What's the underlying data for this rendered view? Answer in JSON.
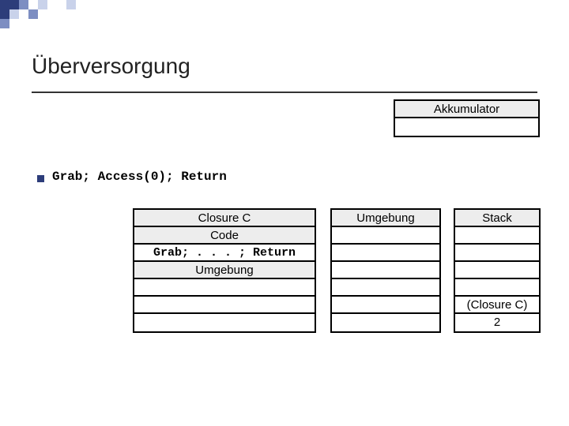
{
  "title": "Überversorgung",
  "akkumulator": {
    "label": "Akkumulator",
    "value": ""
  },
  "bullet_code": "Grab; Access(0); Return",
  "closure": {
    "header": "Closure C",
    "code_label": "Code",
    "code_value": "Grab; . . . ; Return",
    "env_label": "Umgebung",
    "env_rows": [
      "",
      "",
      ""
    ]
  },
  "env_col": {
    "header": "Umgebung",
    "rows": [
      "",
      "",
      "",
      "",
      "",
      ""
    ]
  },
  "stack_col": {
    "header": "Stack",
    "rows": [
      "",
      "",
      "",
      "",
      "(Closure C)",
      "2"
    ]
  }
}
